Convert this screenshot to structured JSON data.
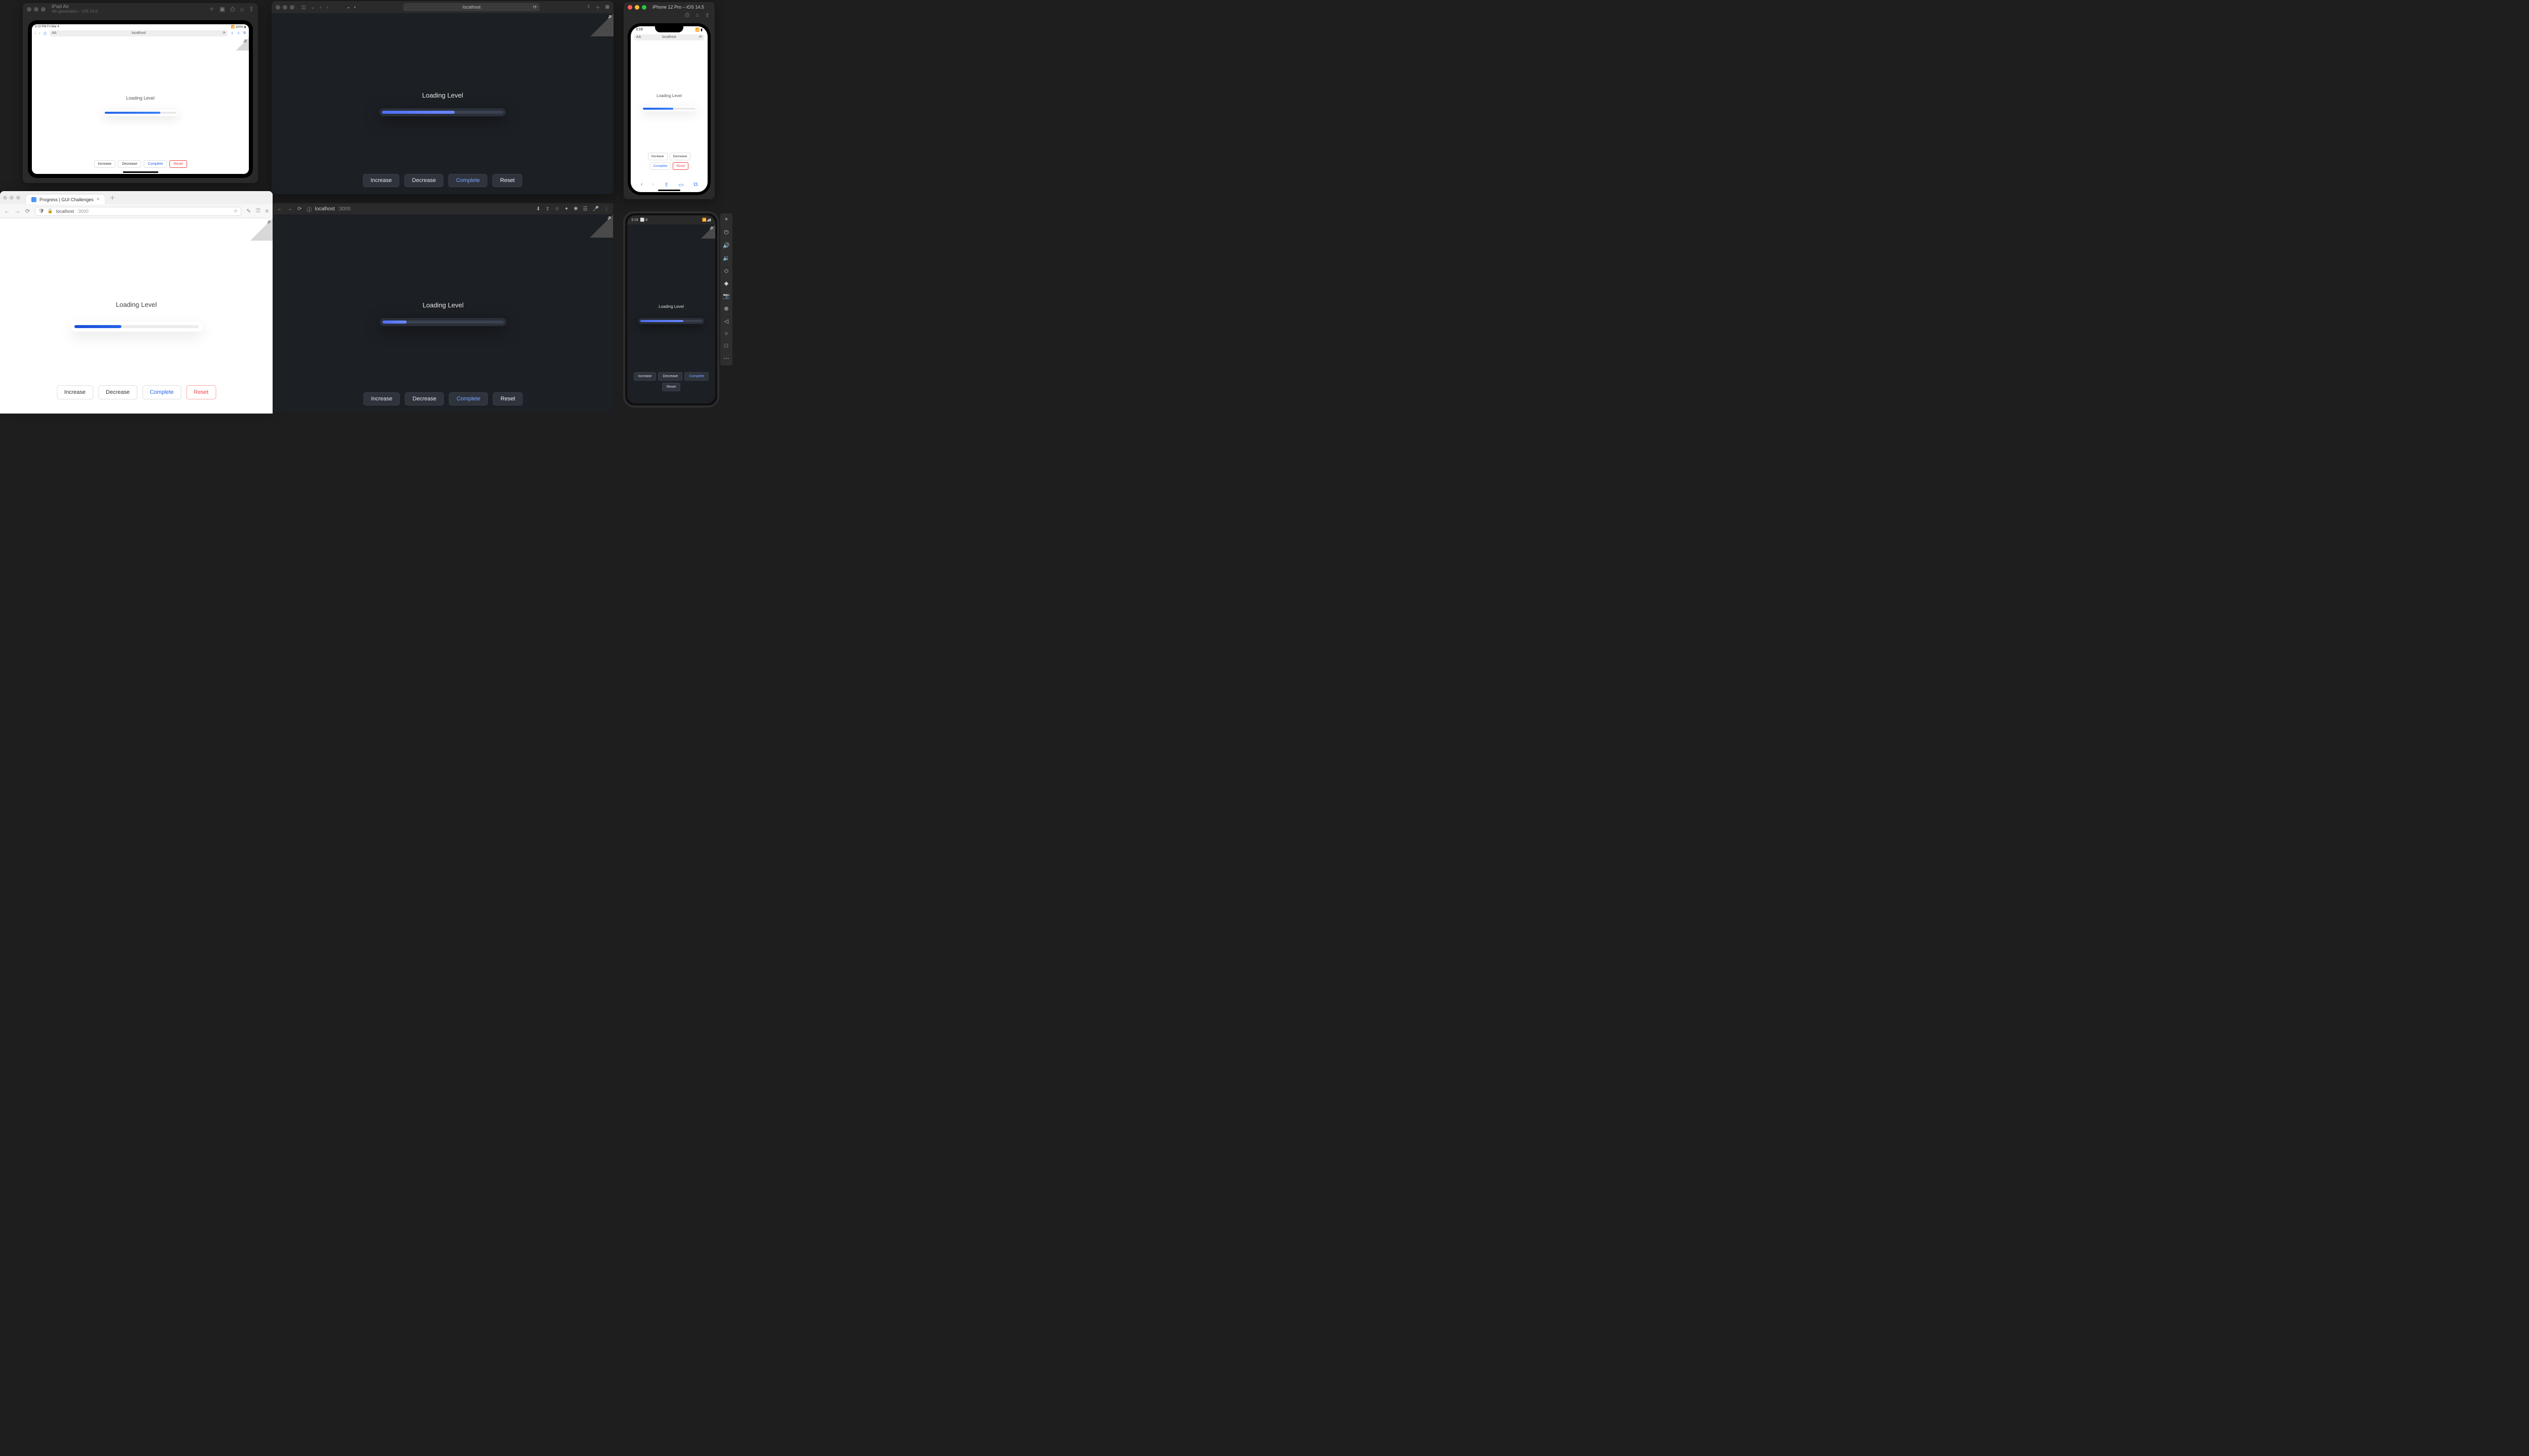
{
  "demo": {
    "heading": "Loading Level",
    "buttons": {
      "increase": "Increase",
      "decrease": "Decrease",
      "complete": "Complete",
      "reset": "Reset"
    }
  },
  "progress": {
    "ipad_pct": 78,
    "safari_pct": 60,
    "firefox_pct": 38,
    "chrome_pct": 20,
    "iphone_pct": 58,
    "android_pct": 70
  },
  "ipad_sim": {
    "title": "iPad Air",
    "subtitle": "4th generation – iOS 14.5",
    "status_left": "8:19 PM   Fri Mar 4",
    "status_right": "100%",
    "url": "localhost"
  },
  "safari": {
    "url": "localhost"
  },
  "iphone_sim": {
    "title": "iPhone 12 Pro – iOS 14.5",
    "time": "3:19",
    "url": "localhost"
  },
  "firefox": {
    "tab_title": "Progress | GUI Challenges",
    "host": "localhost",
    "port": ":3000"
  },
  "chrome": {
    "host": "localhost",
    "port": ":3000"
  },
  "android": {
    "time": "3:19",
    "temp": "8"
  },
  "icons": {
    "back": "‹",
    "fwd": "›",
    "reload": "⟳",
    "share": "⇪",
    "plus": "＋",
    "tabs": "⧉",
    "sidebar": "◫",
    "shield": "◒",
    "contrast": "◐",
    "grid": "▦",
    "star": "☆",
    "ext": "✦",
    "menu": "≡",
    "info": "ⓘ",
    "down": "⬇",
    "puzzle": "✱",
    "dots": "⋮",
    "book": "▭",
    "copy": "⧉",
    "aa": "AA",
    "close": "×",
    "sparkle": "✧",
    "camera": "▣",
    "screenshot": "⎙",
    "home": "⌂",
    "power": "⏻",
    "vol_up": "🔊",
    "vol_down": "🔉",
    "rotate_l": "◇",
    "rotate_r": "◆",
    "cam": "📷",
    "zoom": "⊕",
    "tri": "◁",
    "circle": "○",
    "square": "□",
    "more": "⋯",
    "brush": "✎",
    "key": "⚿",
    "sliders": "☲"
  }
}
